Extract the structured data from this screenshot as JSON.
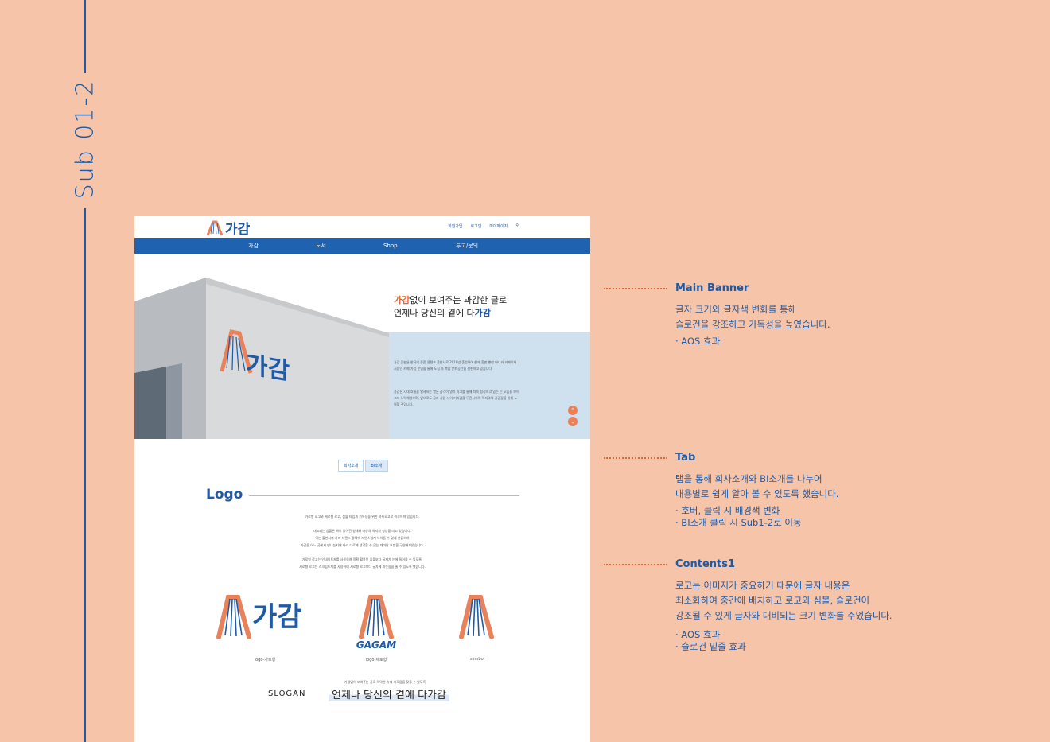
{
  "side_title": "Sub 01-2",
  "mockup": {
    "brand": "가감",
    "util": [
      "회원가입",
      "로그인",
      "마이페이지"
    ],
    "gnb": [
      "가감",
      "도서",
      "Shop",
      "투고/문의"
    ],
    "banner": {
      "slogan_hl1": "가감",
      "slogan_line1_rest": "없이 보여주는 과감한 글로",
      "slogan_line2_pre": "언제나 당신의 곁에 다",
      "slogan_hl2": "가감",
      "para1": "가감 출판은 한국의 종합 콘텐츠 출판사로 2016년 출범하여 현재 출판 뿐만 아니라 카페이자 서점인 카페 가감 운영을 통해 도심 속 복합 문화공간을 실현하고 있습니다.",
      "para2": "가감은 시대 흐름을 탈세하는 알은 감각이 영리 사고를 통해 더욱 성장하고 있는 든 모습을 보이고자 노력해왔으며, 앞으로도 글과 사람 사이 거리감을 두진시하며 독자와의 공감감을 위해 노력할 것입니다."
    },
    "tabs": [
      "회사소개",
      "BI소개"
    ],
    "logo_heading": "Logo",
    "desc_lines": [
      "가로형 로고와 세로형 로고, 심볼 타입과 가독성을 위한 목록로고로 이루어져 있습니다.",
      "",
      "대표되는 심볼은 책이 읽어진 형태와 다양의 의지의 형상을 띠고 있습니다.",
      "이는 출판사와 카페 브랜드 정체에 자연스럽게 녹아들 수 있게 연출하여",
      "가감을 어느 곳에서 만나는지에 따라 다르게 생각할 수 있는 재미난 요방을 구연해보았습니다.",
      "",
      "가로형 로고는 인네이트제를 사용하여 정확 활용된 심볼보다 글자가 눈에 들어올 수 있도록,",
      "세로형 로고는 스크립트체를 사용하여 세로형 로고보다 글자에 따뜻함을 줄 수 있도록 했습니다."
    ],
    "logo_wordmark": "가감",
    "logo_vertical_text": "GAGAM",
    "captions": [
      "logo-가로형",
      "logo-세로형",
      "symbol"
    ],
    "slogan_label": "SLOGAN",
    "slogan_small": "가감없이 보여주는 글로 막막한 속에 새로움을 찾을 수 있도록",
    "slogan_main": "언제나 당신의 곁에 다가감"
  },
  "annotations": [
    {
      "title": "Main Banner",
      "body": [
        "글자 크기와 글자색 변화를 통해",
        "슬로건을 강조하고 가독성을 높였습니다."
      ],
      "bullets": [
        "· AOS 효과"
      ]
    },
    {
      "title": "Tab",
      "body": [
        "탭을 통해 회사소개와 BI소개를 나누어",
        "내용별로 쉽게 알아 볼 수 있도록 했습니다."
      ],
      "bullets": [
        "· 호버, 클릭 시 배경색 변화",
        "· BI소개 클릭 시 Sub1-2로 이동"
      ]
    },
    {
      "title": "Contents1",
      "body": [
        "로고는 이미지가 중요하기 때문에 글자 내용은",
        "최소화하여 중간에 배치하고 로고와 심볼, 슬로건이",
        "강조될 수 있게 글자와 대비되는 크기 변화를 주었습니다."
      ],
      "bullets": [
        "· AOS 효과",
        "· 슬로건 밑줄 효과"
      ]
    }
  ],
  "colors": {
    "background": "#f6c4a8",
    "blue": "#1f5aa6",
    "orange": "#e0673d",
    "nav_blue": "#1f63b0"
  }
}
